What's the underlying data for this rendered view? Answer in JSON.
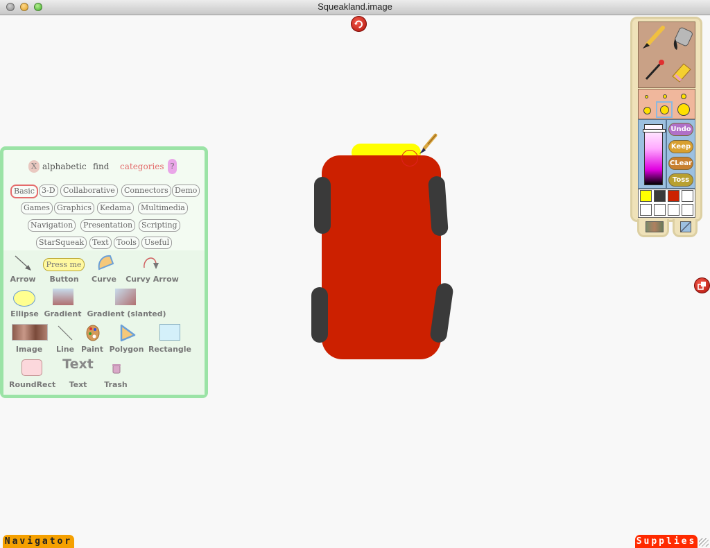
{
  "window": {
    "title": "Squeakland.image"
  },
  "objects_flap": {
    "top_controls": {
      "close": "X",
      "alphabetic": "alphabetic",
      "find": "find",
      "categories": "categories",
      "help": "?"
    },
    "categories": [
      {
        "label": "Basic",
        "selected": true
      },
      {
        "label": "3-D"
      },
      {
        "label": "Collaborative"
      },
      {
        "label": "Connectors"
      },
      {
        "label": "Demo"
      },
      {
        "label": "Games"
      },
      {
        "label": "Graphics"
      },
      {
        "label": "Kedama"
      },
      {
        "label": "Multimedia"
      },
      {
        "label": "Navigation"
      },
      {
        "label": "Presentation"
      },
      {
        "label": "Scripting"
      },
      {
        "label": "StarSqueak"
      },
      {
        "label": "Text"
      },
      {
        "label": "Tools"
      },
      {
        "label": "Useful"
      }
    ],
    "objects": [
      {
        "label": "Arrow",
        "icon": "arrow-icon"
      },
      {
        "label": "Button",
        "icon": "button-icon",
        "icon_text": "Press me"
      },
      {
        "label": "Curve",
        "icon": "curve-icon"
      },
      {
        "label": "Curvy Arrow",
        "icon": "curvy-arrow-icon"
      },
      {
        "label": "Ellipse",
        "icon": "ellipse-icon"
      },
      {
        "label": "Gradient",
        "icon": "gradient-icon"
      },
      {
        "label": "Gradient (slanted)",
        "icon": "gradient-slanted-icon"
      },
      {
        "label": "Image",
        "icon": "image-icon"
      },
      {
        "label": "Line",
        "icon": "line-icon"
      },
      {
        "label": "Paint",
        "icon": "paint-palette-icon"
      },
      {
        "label": "Polygon",
        "icon": "polygon-icon"
      },
      {
        "label": "Rectangle",
        "icon": "rectangle-icon"
      },
      {
        "label": "RoundRect",
        "icon": "roundrect-icon"
      },
      {
        "label": "Text",
        "icon": "text-icon",
        "icon_text": "Text"
      },
      {
        "label": "Trash",
        "icon": "trash-icon"
      }
    ]
  },
  "paint_palette": {
    "tools": [
      "paintbrush-icon",
      "paint-bucket-icon",
      "eyedropper-icon",
      "eraser-icon"
    ],
    "buttons": {
      "undo": "Undo",
      "keep": "Keep",
      "clear": "CLear",
      "toss": "Toss"
    },
    "swatches": [
      "#ffff00",
      "#3a3a3a",
      "#cc2200",
      "#ffffff",
      "#ffffff",
      "#ffffff",
      "#ffffff",
      "#ffffff"
    ]
  },
  "drawing": {
    "body_color": "#cc2000",
    "windshield_color": "#ffff00",
    "tire_color": "#3a3a3a"
  },
  "flaps": {
    "navigator": "Navigator",
    "supplies": "Supplies"
  }
}
